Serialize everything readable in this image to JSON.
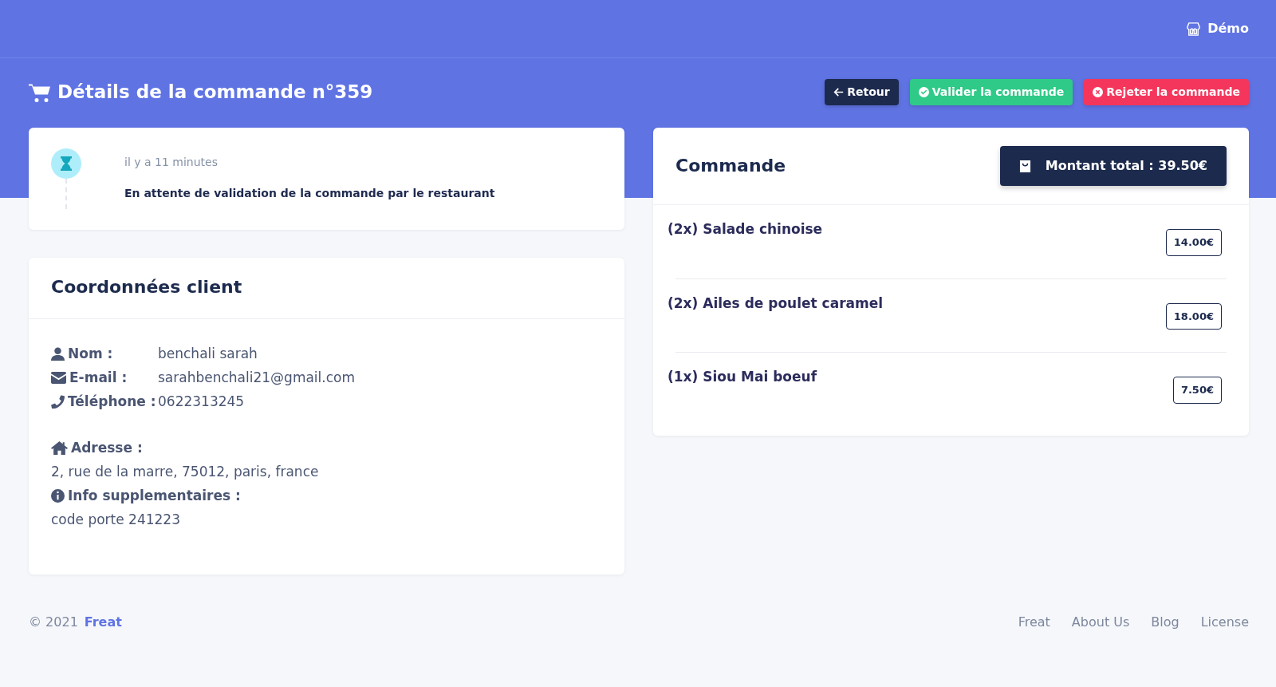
{
  "navbar": {
    "user": "Démo"
  },
  "page_title": "Détails de la commande n°359",
  "actions": [
    {
      "label": "Retour",
      "kind": "back"
    },
    {
      "label": "Valider la commande",
      "kind": "validate"
    },
    {
      "label": "Rejeter la commande",
      "kind": "reject"
    }
  ],
  "timeline": {
    "time": "il y a 11 minutes",
    "message": "En attente de validation de la commande par le restaurant"
  },
  "client": {
    "title": "Coordonnées client",
    "fields": [
      {
        "kind": "name",
        "label": "Nom :",
        "value": "benchali sarah"
      },
      {
        "kind": "email",
        "label": "E-mail :",
        "value": "sarahbenchali21@gmail.com"
      },
      {
        "kind": "phone",
        "label": "Téléphone :",
        "value": "0622313245"
      }
    ],
    "blocks": [
      {
        "kind": "address",
        "label": "Adresse :",
        "value": "2, rue de la marre, 75012, paris, france"
      },
      {
        "kind": "info",
        "label": "Info supplementaires :",
        "value": "code porte 241223"
      }
    ]
  },
  "order": {
    "title": "Commande",
    "total": "Montant total : 39.50€",
    "items": [
      {
        "label": "(2x) Salade chinoise",
        "price": "14.00€"
      },
      {
        "label": "(2x) Ailes de poulet caramel",
        "price": "18.00€"
      },
      {
        "label": "(1x) Siou Mai boeuf",
        "price": "7.50€"
      }
    ]
  },
  "footer": {
    "copyright": "© 2021",
    "brand": "Freat",
    "links": [
      "Freat",
      "About Us",
      "Blog",
      "License"
    ]
  }
}
